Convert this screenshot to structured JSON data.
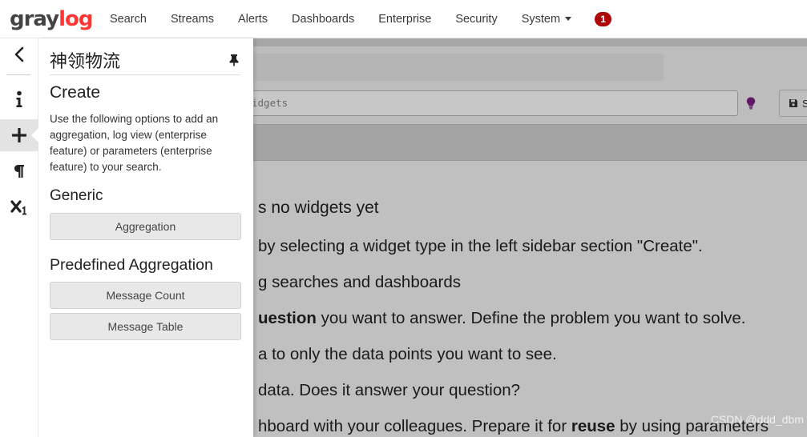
{
  "navbar": {
    "logo": {
      "part1": "gray",
      "part2": "log"
    },
    "items": [
      {
        "label": "Search"
      },
      {
        "label": "Streams"
      },
      {
        "label": "Alerts"
      },
      {
        "label": "Dashboards"
      },
      {
        "label": "Enterprise"
      },
      {
        "label": "Security"
      },
      {
        "label": "System"
      }
    ],
    "notification_count": "1"
  },
  "rail": {
    "icons": [
      "chevron-left-icon",
      "info-icon",
      "plus-icon",
      "paragraph-icon",
      "subscript-icon"
    ],
    "active": "plus-icon"
  },
  "panel": {
    "title": "神领物流",
    "create": {
      "heading": "Create",
      "description": "Use the following options to add an aggregation, log view (enterprise feature) or parameters (enterprise feature) to your search."
    },
    "generic": {
      "heading": "Generic",
      "aggregation_label": "Aggregation"
    },
    "predefined": {
      "heading": "Predefined Aggregation",
      "message_count_label": "Message Count",
      "message_table_label": "Message Table"
    }
  },
  "main": {
    "query_placeholder_visible": "idgets",
    "save_label": "S",
    "empty_state": {
      "heading": "s no widgets yet",
      "line1": "by selecting a widget type in the left sidebar section \"Create\".",
      "line2": "g searches and dashboards",
      "line3_bold": "uestion",
      "line3_rest": " you want to answer. Define the problem you want to solve.",
      "line4": "a to only the data points you want to see.",
      "line5": "data. Does it answer your question?",
      "line6_a": "hboard with your colleagues. Prepare it for ",
      "line6_bold": "reuse",
      "line6_b": " by using parameters"
    }
  },
  "watermark": "CSDN @ddd_dbm",
  "colors": {
    "brand_red": "#ff3633",
    "badge_red": "#ad0707",
    "bulb_purple": "#7a2183"
  }
}
